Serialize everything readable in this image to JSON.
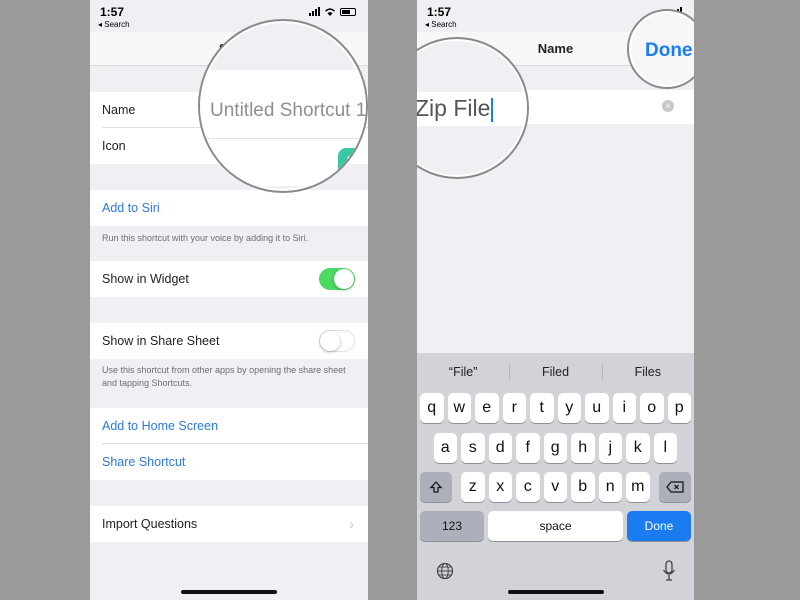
{
  "left": {
    "status": {
      "time": "1:57",
      "back": "◂ Search"
    },
    "nav_title": "Set",
    "name_label": "Name",
    "name_value": "Untitled Shortcut 1",
    "icon_label": "Icon",
    "add_to_siri": "Add to Siri",
    "siri_note": "Run this shortcut with your voice by adding it to Siri.",
    "show_in_widget": {
      "label": "Show in Widget",
      "on": true
    },
    "show_in_share_sheet": {
      "label": "Show in Share Sheet",
      "on": false
    },
    "share_note": "Use this shortcut from other apps by opening the share sheet and tapping Shortcuts.",
    "add_to_home": "Add to Home Screen",
    "share_shortcut": "Share Shortcut",
    "import_questions": "Import Questions"
  },
  "right": {
    "status": {
      "time": "1:57",
      "back": "◂ Search"
    },
    "nav_title": "Name",
    "done_label": "Done",
    "input_value": "Zip File",
    "suggestions": [
      "“File”",
      "Filed",
      "Files"
    ],
    "keys": {
      "row1": [
        "q",
        "w",
        "e",
        "r",
        "t",
        "y",
        "u",
        "i",
        "o",
        "p"
      ],
      "row2": [
        "a",
        "s",
        "d",
        "f",
        "g",
        "h",
        "j",
        "k",
        "l"
      ],
      "row3": [
        "z",
        "x",
        "c",
        "v",
        "b",
        "n",
        "m"
      ],
      "numbers_label": "123",
      "space_label": "space",
      "return_label": "Done"
    }
  },
  "colors": {
    "accent": "#2c7ad6",
    "toggle_on": "#4cd964",
    "keyboard_done": "#1a7cf0"
  },
  "icons": [
    "wifi-icon",
    "battery-icon",
    "signal-icon",
    "shortcut-wand-icon",
    "chevron-right-icon",
    "clear-text-icon",
    "shift-icon",
    "delete-icon",
    "globe-icon",
    "microphone-icon"
  ]
}
